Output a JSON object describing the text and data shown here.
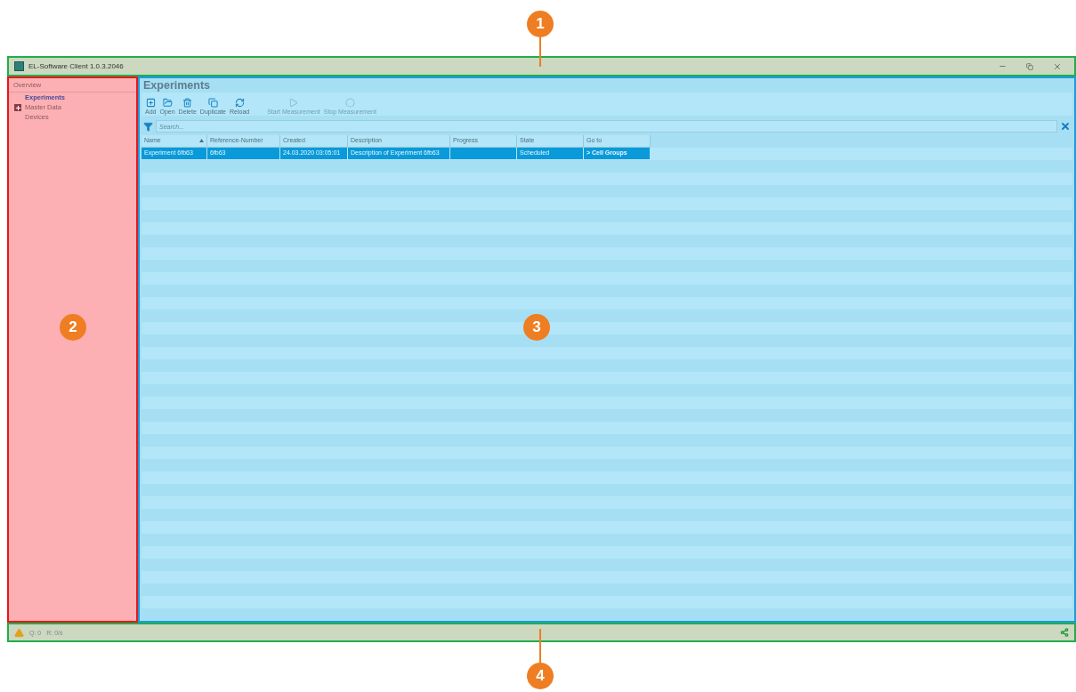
{
  "callouts": [
    {
      "label": "1"
    },
    {
      "label": "2"
    },
    {
      "label": "3"
    },
    {
      "label": "4"
    }
  ],
  "window": {
    "title": "EL-Software Client 1.0.3.2046"
  },
  "sidebar": {
    "header": "Overview",
    "items": [
      {
        "label": "Experiments",
        "selected": true
      },
      {
        "label": "Master Data",
        "selected": false,
        "expandable": true
      },
      {
        "label": "Devices",
        "selected": false
      }
    ]
  },
  "content": {
    "title": "Experiments",
    "toolbar": [
      {
        "label": "Add",
        "disabled": false
      },
      {
        "label": "Open",
        "disabled": false
      },
      {
        "label": "Delete",
        "disabled": false
      },
      {
        "label": "Duplicate",
        "disabled": false
      },
      {
        "label": "Reload",
        "disabled": false
      },
      {
        "label": "Start Measurement",
        "disabled": true
      },
      {
        "label": "Stop Measurement",
        "disabled": true
      }
    ],
    "search": {
      "placeholder": "Search..."
    },
    "table": {
      "columns": [
        {
          "label": "Name",
          "sorted": true
        },
        {
          "label": "Reference-Number",
          "sorted": false
        },
        {
          "label": "Created",
          "sorted": false
        },
        {
          "label": "Description",
          "sorted": false
        },
        {
          "label": "Progress",
          "sorted": false
        },
        {
          "label": "State",
          "sorted": false
        },
        {
          "label": "Go to",
          "sorted": false
        }
      ],
      "rows": [
        {
          "selected": true,
          "cells": [
            "Experiment 6fb63",
            "6fb63",
            "24.03.2020 03:05:01",
            "Description of Experiment 6fb63",
            "",
            "Scheduled",
            "> Cell Groups"
          ]
        }
      ]
    }
  },
  "status_bar": {
    "queue": "Q: 0",
    "rate": "R: 0/s"
  }
}
